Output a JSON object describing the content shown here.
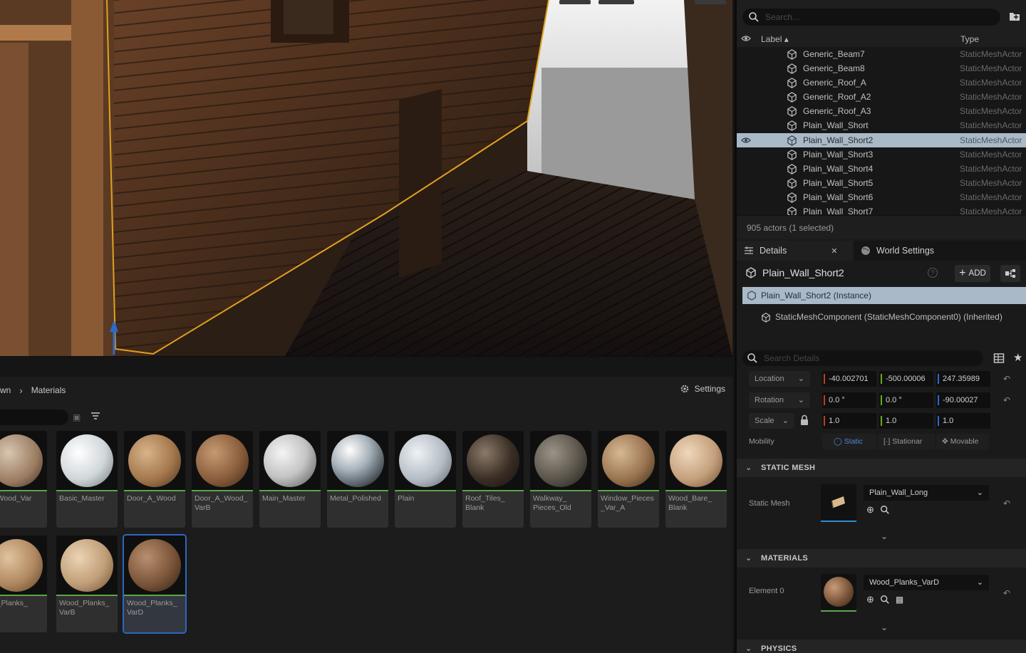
{
  "content_browser": {
    "breadcrumb": [
      "wn",
      "Materials"
    ],
    "settings_label": "Settings",
    "assets": [
      {
        "name": "e_Wood_Var",
        "ball": "radial-gradient(circle at 35% 35%, #d8c6b0, #9a7a60 60%, #3a2a20)"
      },
      {
        "name": "Basic_Master",
        "ball": "radial-gradient(circle at 35% 35%, #ffffff, #cfd6da 55%, #6a7074)"
      },
      {
        "name": "Door_A_Wood",
        "ball": "radial-gradient(circle at 35% 35%, #d8b48a, #a4784c 55%, #4a3020)"
      },
      {
        "name": "Door_A_Wood_\nVarB",
        "ball": "radial-gradient(circle at 35% 35%, #c69a72, #8a5e3c 55%, #3a2418)"
      },
      {
        "name": "Main_Master",
        "ball": "radial-gradient(circle at 35% 35%, #f4f4f4, #c4c4c4 50%, #505050)"
      },
      {
        "name": "Metal_Polished",
        "ball": "radial-gradient(circle at 35% 30%, #ffffff, #a8b2ba 40%, #3a4248 80%)"
      },
      {
        "name": "Plain",
        "ball": "radial-gradient(circle at 35% 35%, #eef2f6, #b4bcc4 55%, #5a6068)"
      },
      {
        "name": "Roof_Tiles_\nBlank",
        "ball": "radial-gradient(circle at 35% 35%, #8a7a6a, #3a2e24 55%, #121010)"
      },
      {
        "name": "Walkway_\nPieces_Old",
        "ball": "radial-gradient(circle at 35% 35%, #9a9488, #5a544a 55%, #1e1c18)"
      },
      {
        "name": "Window_Pieces\n_Var_A",
        "ball": "radial-gradient(circle at 35% 35%, #d6b894, #9a7450 55%, #3a2818)"
      },
      {
        "name": "Wood_Bare_\nBlank",
        "ball": "radial-gradient(circle at 35% 35%, #efd8bc, #c4a07c 55%, #6a4a30)"
      },
      {
        "name": "od_Planks_\noA",
        "ball": "radial-gradient(circle at 35% 35%, #e0c4a0, #b08860 55%, #5a3e26)"
      },
      {
        "name": "Wood_Planks_\nVarB",
        "ball": "radial-gradient(circle at 35% 35%, #ecd4b4, #c09e78 55%, #6a4c32)"
      },
      {
        "name": "Wood_Planks_\nVarD",
        "ball": "radial-gradient(circle at 35% 35%, #b89070, #7a5438 55%, #2e1e12)"
      }
    ]
  },
  "outliner": {
    "search_placeholder": "Search...",
    "col_label": "Label",
    "col_type": "Type",
    "rows": [
      {
        "label": "Generic_Beam7",
        "type": "StaticMeshActor"
      },
      {
        "label": "Generic_Beam8",
        "type": "StaticMeshActor"
      },
      {
        "label": "Generic_Roof_A",
        "type": "StaticMeshActor"
      },
      {
        "label": "Generic_Roof_A2",
        "type": "StaticMeshActor"
      },
      {
        "label": "Generic_Roof_A3",
        "type": "StaticMeshActor"
      },
      {
        "label": "Plain_Wall_Short",
        "type": "StaticMeshActor"
      },
      {
        "label": "Plain_Wall_Short2",
        "type": "StaticMeshActor"
      },
      {
        "label": "Plain_Wall_Short3",
        "type": "StaticMeshActor"
      },
      {
        "label": "Plain_Wall_Short4",
        "type": "StaticMeshActor"
      },
      {
        "label": "Plain_Wall_Short5",
        "type": "StaticMeshActor"
      },
      {
        "label": "Plain_Wall_Short6",
        "type": "StaticMeshActor"
      },
      {
        "label": "Plain_Wall_Short7",
        "type": "StaticMeshActor"
      }
    ],
    "footer": "905 actors (1 selected)"
  },
  "details": {
    "tab_details": "Details",
    "tab_world": "World Settings",
    "actor_name": "Plain_Wall_Short2",
    "add_label": "ADD",
    "instance_label": "Plain_Wall_Short2 (Instance)",
    "component_label": "StaticMeshComponent (StaticMeshComponent0) (Inherited)",
    "search_placeholder": "Search Details",
    "location": {
      "label": "Location",
      "x": "-40.002701",
      "y": "-500.00006",
      "z": "247.35989"
    },
    "rotation": {
      "label": "Rotation",
      "x": "0.0 °",
      "y": "0.0 °",
      "z": "-90.00027"
    },
    "scale": {
      "label": "Scale",
      "x": "1.0",
      "y": "1.0",
      "z": "1.0"
    },
    "mobility": {
      "label": "Mobility",
      "static": "Static",
      "stationary": "Stationar",
      "movable": "Movable"
    },
    "static_mesh_section": "STATIC MESH",
    "static_mesh_label": "Static Mesh",
    "static_mesh_value": "Plain_Wall_Long",
    "materials_section": "MATERIALS",
    "element_label": "Element 0",
    "element_value": "Wood_Planks_VarD",
    "physics_section": "PHYSICS"
  }
}
